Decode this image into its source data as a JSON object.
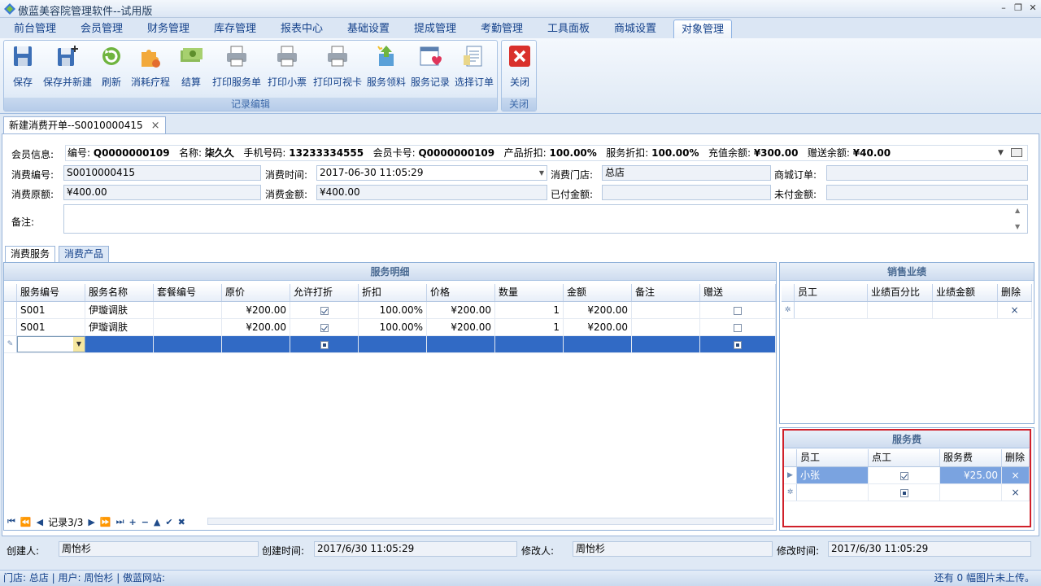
{
  "app": {
    "title": "傲蓝美容院管理软件--试用版"
  },
  "ribbon_tabs": [
    "前台管理",
    "会员管理",
    "财务管理",
    "库存管理",
    "报表中心",
    "基础设置",
    "提成管理",
    "考勤管理",
    "工具面板",
    "商城设置",
    "对象管理"
  ],
  "ribbon": {
    "group1_label": "记录编辑",
    "group2_label": "关闭",
    "buttons": [
      "保存",
      "保存并新建",
      "刷新",
      "消耗疗程",
      "结算",
      "打印服务单",
      "打印小票",
      "打印可视卡",
      "服务领料",
      "服务记录",
      "选择订单"
    ],
    "close_label": "关闭"
  },
  "doc_tab": {
    "label": "新建消费开单--S0010000415",
    "close": "×"
  },
  "member": {
    "label": "会员信息:",
    "text_parts": [
      {
        "k": "编号:",
        "v": "Q0000000109"
      },
      {
        "k": "名称:",
        "v": "柒久久"
      },
      {
        "k": "手机号码:",
        "v": "13233334555"
      },
      {
        "k": "会员卡号:",
        "v": "Q0000000109"
      },
      {
        "k": "产品折扣:",
        "v": "100.00%"
      },
      {
        "k": "服务折扣:",
        "v": "100.00%"
      },
      {
        "k": "充值余额:",
        "v": "¥300.00"
      },
      {
        "k": "赠送余额:",
        "v": "¥40.00"
      }
    ]
  },
  "form": {
    "order_no_label": "消费编号:",
    "order_no": "S0010000415",
    "time_label": "消费时间:",
    "time": "2017-06-30 11:05:29",
    "store_label": "消费门店:",
    "store": "总店",
    "mall_label": "商城订单:",
    "mall": "",
    "orig_label": "消费原额:",
    "orig": "¥400.00",
    "amount_label": "消费金额:",
    "amount": "¥400.00",
    "paid_label": "已付金额:",
    "paid": "",
    "unpaid_label": "未付金额:",
    "unpaid": "",
    "note_label": "备注:",
    "note": ""
  },
  "inner_tabs": [
    "消费服务",
    "消费产品"
  ],
  "service_grid": {
    "title": "服务明细",
    "columns": [
      "服务编号",
      "服务名称",
      "套餐编号",
      "原价",
      "允许打折",
      "折扣",
      "价格",
      "数量",
      "金额",
      "备注",
      "赠送"
    ],
    "rows": [
      {
        "code": "S001",
        "name": "伊璇调肤",
        "pkg": "",
        "price": "¥200.00",
        "allow": true,
        "disc": "100.00%",
        "final": "¥200.00",
        "qty": "1",
        "amount": "¥200.00",
        "note": "",
        "gift": false
      },
      {
        "code": "S001",
        "name": "伊璇调肤",
        "pkg": "",
        "price": "¥200.00",
        "allow": true,
        "disc": "100.00%",
        "final": "¥200.00",
        "qty": "1",
        "amount": "¥200.00",
        "note": "",
        "gift": false
      }
    ],
    "record_text": "记录3/3"
  },
  "sales_grid": {
    "title": "销售业绩",
    "columns": [
      "员工",
      "业绩百分比",
      "业绩金额",
      "删除"
    ],
    "delete_mark": "×"
  },
  "fee_grid": {
    "title": "服务费",
    "columns": [
      "员工",
      "点工",
      "服务费",
      "删除"
    ],
    "rows": [
      {
        "staff": "小张",
        "point": true,
        "fee": "¥25.00"
      }
    ],
    "delete_mark": "×"
  },
  "footer": {
    "creator_label": "创建人:",
    "creator": "周怡杉",
    "ctime_label": "创建时间:",
    "ctime": "2017/6/30 11:05:29",
    "modifier_label": "修改人:",
    "modifier": "周怡杉",
    "mtime_label": "修改时间:",
    "mtime": "2017/6/30 11:05:29"
  },
  "status": {
    "left": "门店: 总店 | 用户: 周怡杉 | 傲蓝网站:",
    "right": "还有 0 幅图片未上传。"
  },
  "colors": {
    "accent": "#316ac5",
    "highlight_border": "#d0202a",
    "panel_title": "#4a6a92"
  }
}
